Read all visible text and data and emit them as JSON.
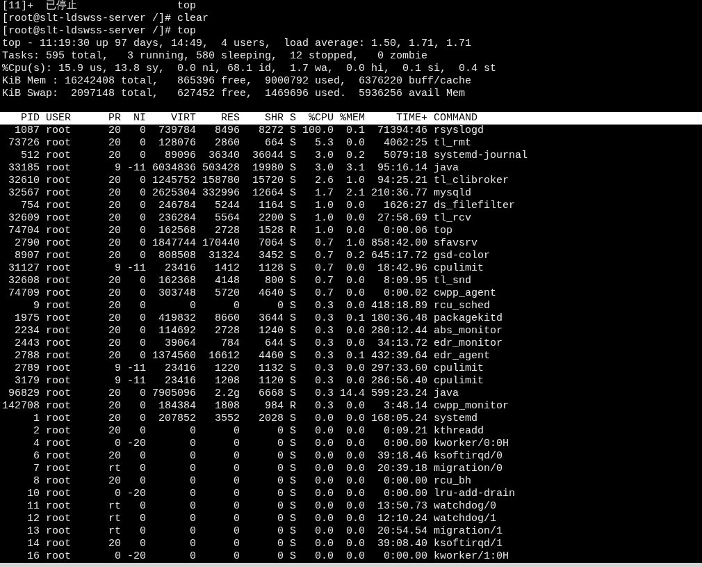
{
  "jobs_line": {
    "job": "[11]+",
    "status": "已停止",
    "command": "top"
  },
  "prompts": [
    {
      "prompt": "[root@slt-ldswss-server /]#",
      "command": "clear"
    },
    {
      "prompt": "[root@slt-ldswss-server /]#",
      "command": "top"
    }
  ],
  "summary": [
    "top - 11:19:30 up 97 days, 14:49,  4 users,  load average: 1.50, 1.71, 1.71",
    "Tasks: 595 total,   3 running, 580 sleeping,  12 stopped,   0 zombie",
    "%Cpu(s): 15.9 us, 13.8 sy,  0.0 ni, 68.1 id,  1.7 wa,  0.0 hi,  0.1 si,  0.4 st",
    "KiB Mem : 16242408 total,   865396 free,  9000792 used,  6376220 buff/cache",
    "KiB Swap:  2097148 total,   627452 free,  1469696 used.  5936256 avail Mem"
  ],
  "table": {
    "columns": [
      "PID",
      "USER",
      "PR",
      "NI",
      "VIRT",
      "RES",
      "SHR",
      "S",
      "%CPU",
      "%MEM",
      "TIME+",
      "COMMAND"
    ],
    "rows": [
      [
        "1087",
        "root",
        "20",
        "0",
        "739784",
        "8496",
        "8272",
        "S",
        "100.0",
        "0.1",
        "71394:46",
        "rsyslogd"
      ],
      [
        "73726",
        "root",
        "20",
        "0",
        "128076",
        "2860",
        "664",
        "S",
        "5.3",
        "0.0",
        "4062:25",
        "tl_rmt"
      ],
      [
        "512",
        "root",
        "20",
        "0",
        "89096",
        "36340",
        "36044",
        "S",
        "3.0",
        "0.2",
        "5079:18",
        "systemd-journal"
      ],
      [
        "33185",
        "root",
        "9",
        "-11",
        "6034836",
        "503428",
        "19980",
        "S",
        "3.0",
        "3.1",
        "95:16.14",
        "java"
      ],
      [
        "32610",
        "root",
        "20",
        "0",
        "1245752",
        "158780",
        "15720",
        "S",
        "2.6",
        "1.0",
        "94:25.21",
        "tl_clibroker"
      ],
      [
        "32567",
        "root",
        "20",
        "0",
        "2625304",
        "332996",
        "12664",
        "S",
        "1.7",
        "2.1",
        "210:36.77",
        "mysqld"
      ],
      [
        "754",
        "root",
        "20",
        "0",
        "246784",
        "5244",
        "1164",
        "S",
        "1.0",
        "0.0",
        "1626:27",
        "ds_filefilter"
      ],
      [
        "32609",
        "root",
        "20",
        "0",
        "236284",
        "5564",
        "2200",
        "S",
        "1.0",
        "0.0",
        "27:58.69",
        "tl_rcv"
      ],
      [
        "74704",
        "root",
        "20",
        "0",
        "162568",
        "2728",
        "1528",
        "R",
        "1.0",
        "0.0",
        "0:00.06",
        "top"
      ],
      [
        "2790",
        "root",
        "20",
        "0",
        "1847744",
        "170440",
        "7064",
        "S",
        "0.7",
        "1.0",
        "858:42.00",
        "sfavsrv"
      ],
      [
        "8907",
        "root",
        "20",
        "0",
        "808508",
        "31324",
        "3452",
        "S",
        "0.7",
        "0.2",
        "645:17.72",
        "gsd-color"
      ],
      [
        "31127",
        "root",
        "9",
        "-11",
        "23416",
        "1412",
        "1128",
        "S",
        "0.7",
        "0.0",
        "18:42.96",
        "cpulimit"
      ],
      [
        "32608",
        "root",
        "20",
        "0",
        "162368",
        "4148",
        "800",
        "S",
        "0.7",
        "0.0",
        "8:09.95",
        "tl_snd"
      ],
      [
        "74709",
        "root",
        "20",
        "0",
        "303748",
        "5720",
        "4640",
        "S",
        "0.7",
        "0.0",
        "0:00.02",
        "cwpp_agent"
      ],
      [
        "9",
        "root",
        "20",
        "0",
        "0",
        "0",
        "0",
        "S",
        "0.3",
        "0.0",
        "418:18.89",
        "rcu_sched"
      ],
      [
        "1975",
        "root",
        "20",
        "0",
        "419832",
        "8660",
        "3644",
        "S",
        "0.3",
        "0.1",
        "180:36.48",
        "packagekitd"
      ],
      [
        "2234",
        "root",
        "20",
        "0",
        "114692",
        "2728",
        "1240",
        "S",
        "0.3",
        "0.0",
        "280:12.44",
        "abs_monitor"
      ],
      [
        "2443",
        "root",
        "20",
        "0",
        "39064",
        "784",
        "644",
        "S",
        "0.3",
        "0.0",
        "34:13.72",
        "edr_monitor"
      ],
      [
        "2788",
        "root",
        "20",
        "0",
        "1374560",
        "16612",
        "4460",
        "S",
        "0.3",
        "0.1",
        "432:39.64",
        "edr_agent"
      ],
      [
        "2789",
        "root",
        "9",
        "-11",
        "23416",
        "1220",
        "1132",
        "S",
        "0.3",
        "0.0",
        "297:33.60",
        "cpulimit"
      ],
      [
        "3179",
        "root",
        "9",
        "-11",
        "23416",
        "1208",
        "1120",
        "S",
        "0.3",
        "0.0",
        "286:56.40",
        "cpulimit"
      ],
      [
        "96829",
        "root",
        "20",
        "0",
        "7905096",
        "2.2g",
        "6668",
        "S",
        "0.3",
        "14.4",
        "599:23.24",
        "java"
      ],
      [
        "142708",
        "root",
        "20",
        "0",
        "184384",
        "1808",
        "984",
        "R",
        "0.3",
        "0.0",
        "3:48.14",
        "cwpp_monitor"
      ],
      [
        "1",
        "root",
        "20",
        "0",
        "207852",
        "3552",
        "2028",
        "S",
        "0.0",
        "0.0",
        "168:05.24",
        "systemd"
      ],
      [
        "2",
        "root",
        "20",
        "0",
        "0",
        "0",
        "0",
        "S",
        "0.0",
        "0.0",
        "0:09.21",
        "kthreadd"
      ],
      [
        "4",
        "root",
        "0",
        "-20",
        "0",
        "0",
        "0",
        "S",
        "0.0",
        "0.0",
        "0:00.00",
        "kworker/0:0H"
      ],
      [
        "6",
        "root",
        "20",
        "0",
        "0",
        "0",
        "0",
        "S",
        "0.0",
        "0.0",
        "39:18.46",
        "ksoftirqd/0"
      ],
      [
        "7",
        "root",
        "rt",
        "0",
        "0",
        "0",
        "0",
        "S",
        "0.0",
        "0.0",
        "20:39.18",
        "migration/0"
      ],
      [
        "8",
        "root",
        "20",
        "0",
        "0",
        "0",
        "0",
        "S",
        "0.0",
        "0.0",
        "0:00.00",
        "rcu_bh"
      ],
      [
        "10",
        "root",
        "0",
        "-20",
        "0",
        "0",
        "0",
        "S",
        "0.0",
        "0.0",
        "0:00.00",
        "lru-add-drain"
      ],
      [
        "11",
        "root",
        "rt",
        "0",
        "0",
        "0",
        "0",
        "S",
        "0.0",
        "0.0",
        "13:50.73",
        "watchdog/0"
      ],
      [
        "12",
        "root",
        "rt",
        "0",
        "0",
        "0",
        "0",
        "S",
        "0.0",
        "0.0",
        "12:10.24",
        "watchdog/1"
      ],
      [
        "13",
        "root",
        "rt",
        "0",
        "0",
        "0",
        "0",
        "S",
        "0.0",
        "0.0",
        "20:54.54",
        "migration/1"
      ],
      [
        "14",
        "root",
        "20",
        "0",
        "0",
        "0",
        "0",
        "S",
        "0.0",
        "0.0",
        "39:08.40",
        "ksoftirqd/1"
      ],
      [
        "16",
        "root",
        "0",
        "-20",
        "0",
        "0",
        "0",
        "S",
        "0.0",
        "0.0",
        "0:00.00",
        "kworker/1:0H"
      ]
    ]
  }
}
